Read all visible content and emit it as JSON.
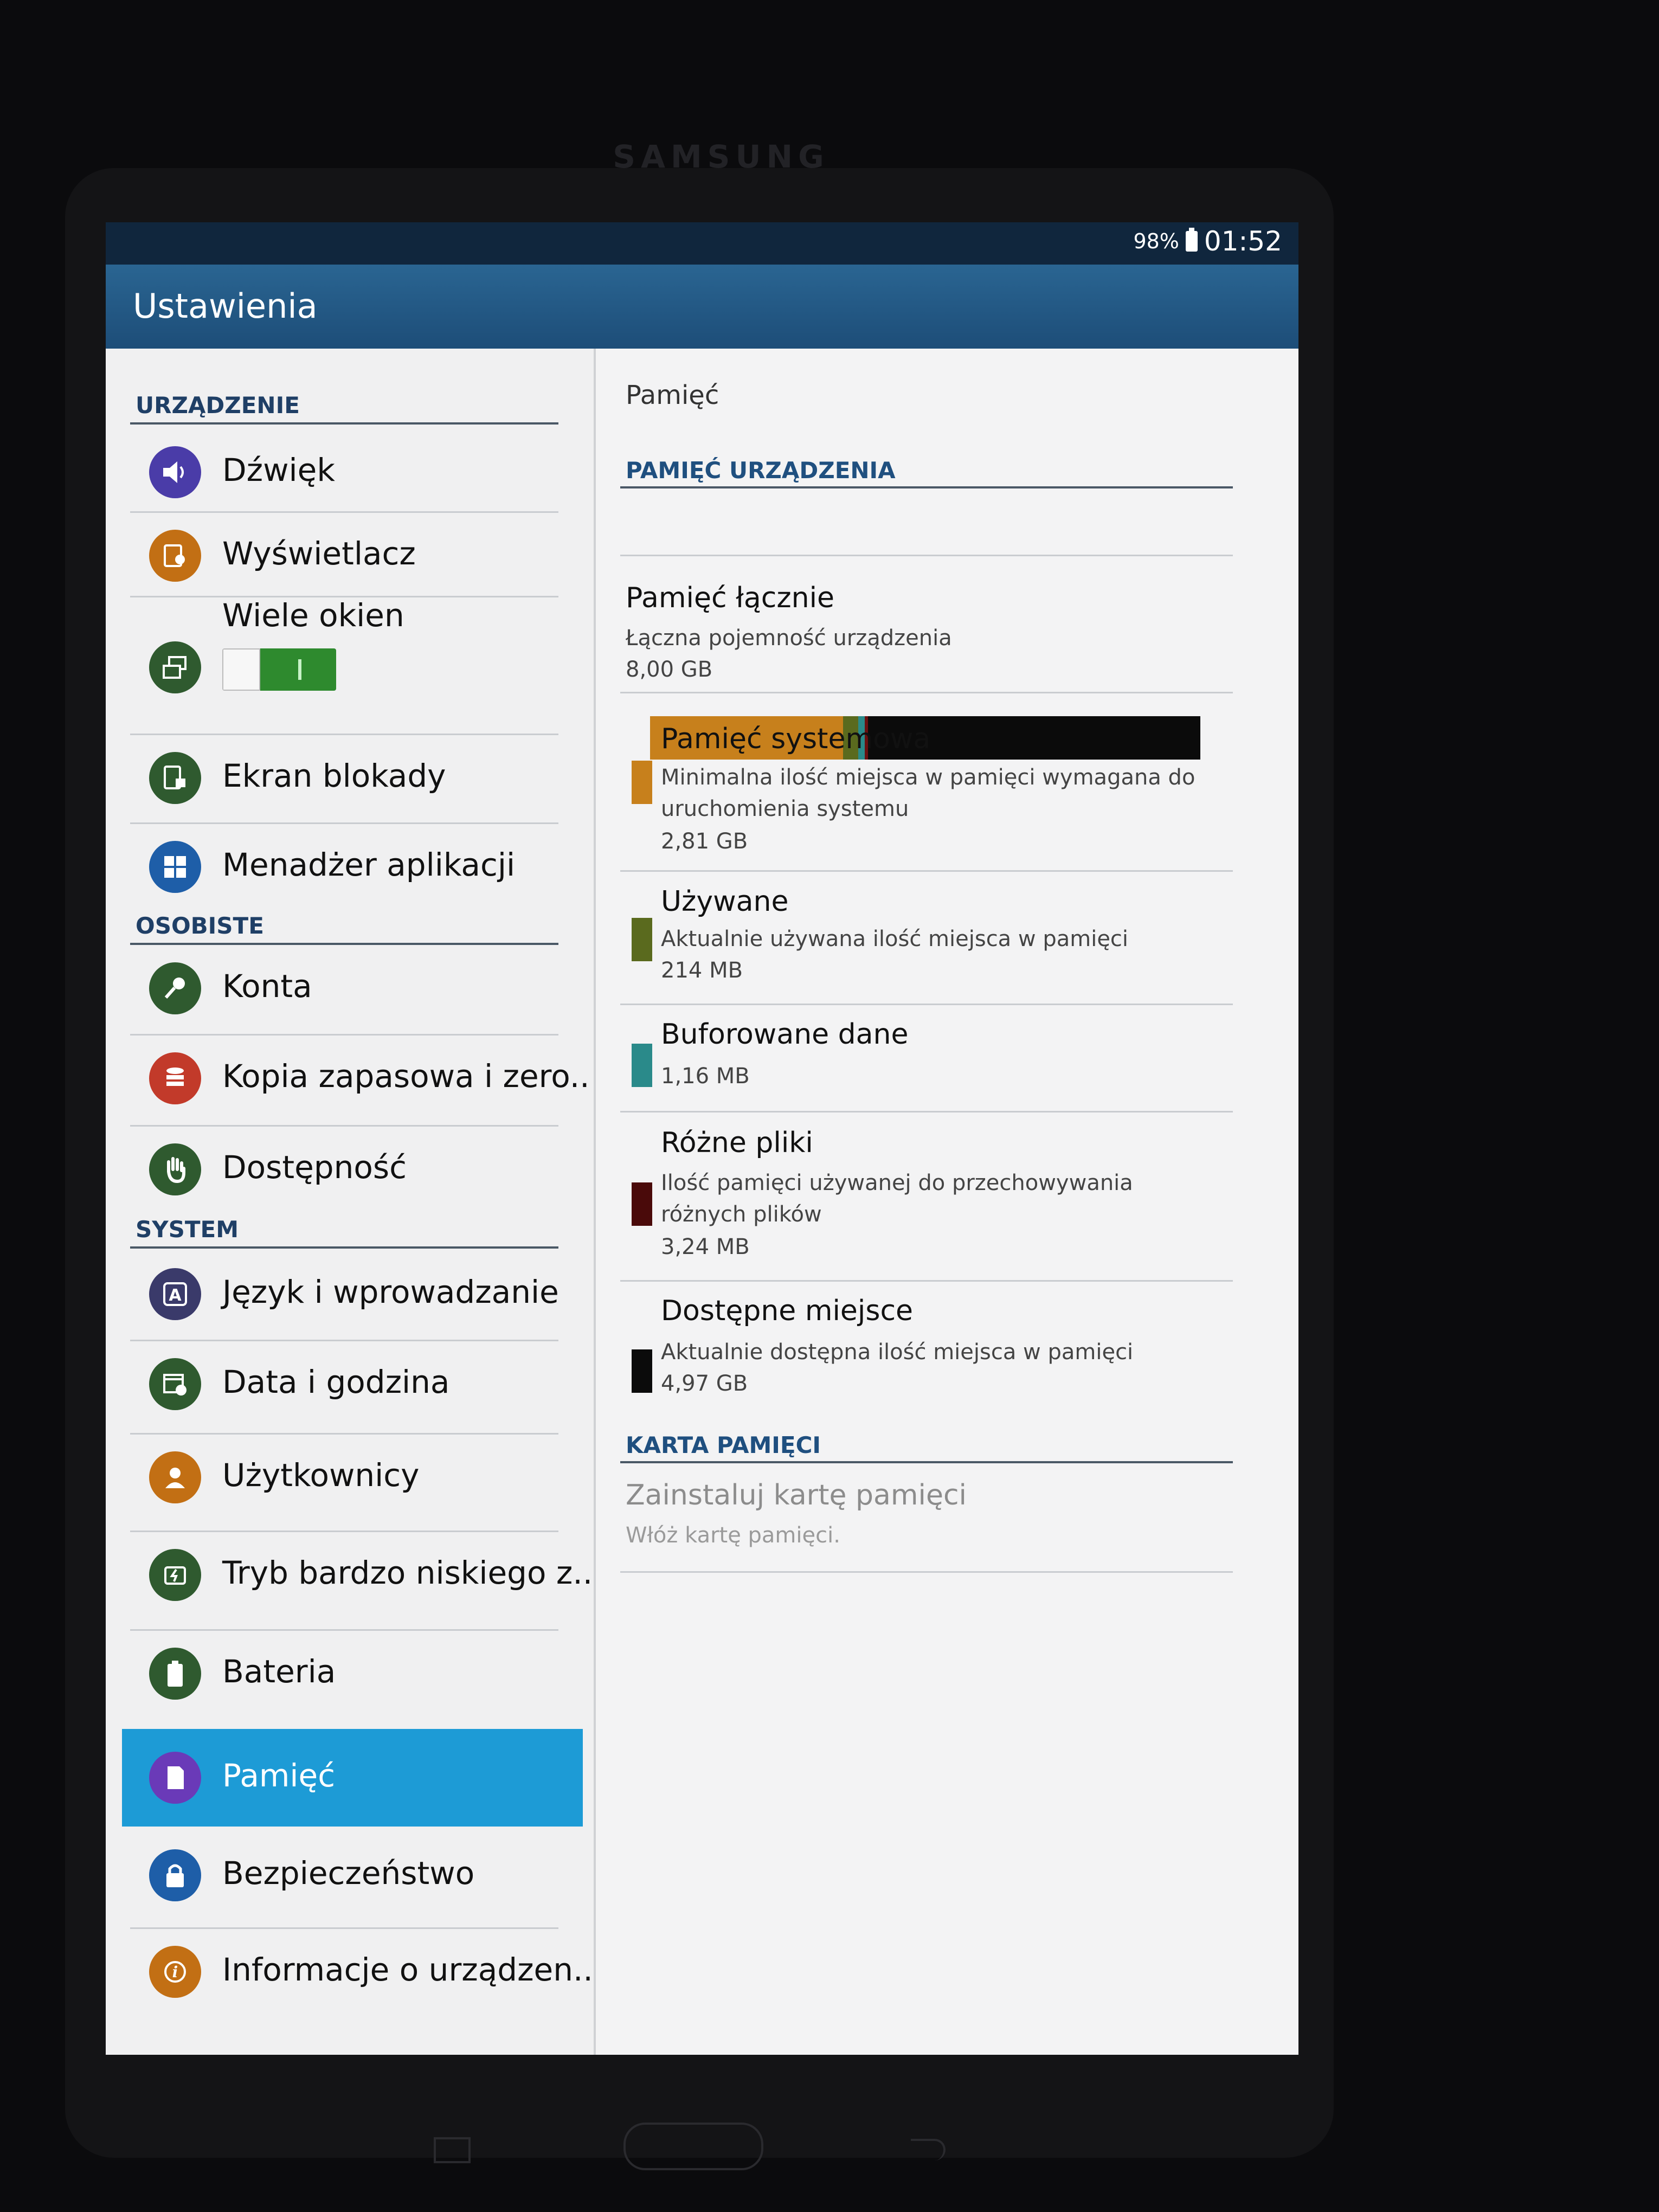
{
  "device": {
    "brand": "SAMSUNG"
  },
  "statusbar": {
    "battery": "98%",
    "time": "01:52"
  },
  "app": {
    "title": "Ustawienia"
  },
  "sidebar": {
    "sections": {
      "device": "URZĄDZENIE",
      "personal": "OSOBISTE",
      "system": "SYSTEM"
    },
    "items": [
      {
        "label": "Dźwięk",
        "icon": "speaker-icon",
        "color": "#4a3ca8"
      },
      {
        "label": "Wyświetlacz",
        "icon": "display-icon",
        "color": "#c26f14"
      },
      {
        "label": "Wiele okien",
        "icon": "multi-window-icon",
        "color": "#2f5a2f",
        "toggle": true
      },
      {
        "label": "Ekran blokady",
        "icon": "lock-screen-icon",
        "color": "#2f5a2f"
      },
      {
        "label": "Menadżer aplikacji",
        "icon": "app-grid-icon",
        "color": "#1e5ea8"
      },
      {
        "label": "Konta",
        "icon": "key-icon",
        "color": "#2f5a2f"
      },
      {
        "label": "Kopia zapasowa i zero..",
        "icon": "backup-icon",
        "color": "#c23a2a"
      },
      {
        "label": "Dostępność",
        "icon": "hand-icon",
        "color": "#2f5a2f"
      },
      {
        "label": "Język i wprowadzanie",
        "icon": "language-icon",
        "color": "#3a3a6a"
      },
      {
        "label": "Data i godzina",
        "icon": "calendar-icon",
        "color": "#2f5a2f"
      },
      {
        "label": "Użytkownicy",
        "icon": "user-icon",
        "color": "#c26f14"
      },
      {
        "label": "Tryb bardzo niskiego z..",
        "icon": "power-saving-icon",
        "color": "#2f5a2f"
      },
      {
        "label": "Bateria",
        "icon": "battery-icon",
        "color": "#2f5a2f"
      },
      {
        "label": "Pamięć",
        "icon": "storage-icon",
        "color": "#6a3ab8",
        "selected": true
      },
      {
        "label": "Bezpieczeństwo",
        "icon": "padlock-icon",
        "color": "#1e5ea8"
      },
      {
        "label": "Informacje o urządzen..",
        "icon": "info-icon",
        "color": "#c26f14"
      }
    ]
  },
  "storage": {
    "title": "Pamięć",
    "device_header": "PAMIĘĆ URZĄDZENIA",
    "usage_bar": [
      {
        "name": "system",
        "fraction": 0.351,
        "color": "#c7801c"
      },
      {
        "name": "used",
        "fraction": 0.027,
        "color": "#5a6a1e"
      },
      {
        "name": "cached",
        "fraction": 0.012,
        "color": "#2a8a8a"
      },
      {
        "name": "misc",
        "fraction": 0.006,
        "color": "#6a1010"
      },
      {
        "name": "free",
        "fraction": 0.604,
        "color": "#0b0b0b"
      }
    ],
    "total": {
      "title": "Pamięć łącznie",
      "subtitle": "Łączna pojemność urządzenia",
      "value": "8,00 GB"
    },
    "entries": [
      {
        "title": "Pamięć systemowa",
        "subtitle": "Minimalna ilość miejsca w pamięci wymagana do uruchomienia systemu",
        "value": "2,81 GB",
        "color": "#c7801c"
      },
      {
        "title": "Używane",
        "subtitle": "Aktualnie używana ilość miejsca w pamięci",
        "value": "214 MB",
        "color": "#5a6a1e"
      },
      {
        "title": "Buforowane dane",
        "subtitle": "",
        "value": "1,16 MB",
        "color": "#2a8a8a"
      },
      {
        "title": "Różne pliki",
        "subtitle": "Ilość pamięci używanej do przechowywania różnych plików",
        "value": "3,24 MB",
        "color": "#4a0a0a"
      },
      {
        "title": "Dostępne miejsce",
        "subtitle": "Aktualnie dostępna ilość miejsca w pamięci",
        "value": "4,97 GB",
        "color": "#0b0b0b"
      }
    ],
    "card_header": "KARTA PAMIĘCI",
    "card": {
      "title": "Zainstaluj kartę pamięci",
      "subtitle": "Włóż kartę pamięci."
    }
  }
}
